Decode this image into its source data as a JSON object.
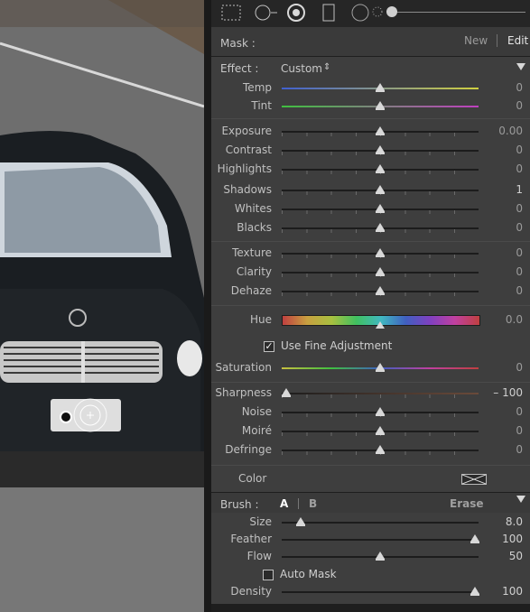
{
  "toolbar": {
    "tools": [
      "grid-select-icon",
      "radial-add-icon",
      "radial-filter-icon",
      "graduated-filter-icon",
      "circle-icon",
      "brightness-icon"
    ]
  },
  "mask": {
    "label": "Mask :",
    "new_label": "New",
    "edit_label": "Edit"
  },
  "effect": {
    "label": "Effect :",
    "preset": "Custom"
  },
  "sliders": {
    "temp": {
      "label": "Temp",
      "value": "0",
      "pos": 0.5
    },
    "tint": {
      "label": "Tint",
      "value": "0",
      "pos": 0.5
    },
    "exposure": {
      "label": "Exposure",
      "value": "0.00",
      "pos": 0.5
    },
    "contrast": {
      "label": "Contrast",
      "value": "0",
      "pos": 0.5
    },
    "highlights": {
      "label": "Highlights",
      "value": "0",
      "pos": 0.5
    },
    "shadows": {
      "label": "Shadows",
      "value": "1",
      "pos": 0.5
    },
    "whites": {
      "label": "Whites",
      "value": "0",
      "pos": 0.5
    },
    "blacks": {
      "label": "Blacks",
      "value": "0",
      "pos": 0.5
    },
    "texture": {
      "label": "Texture",
      "value": "0",
      "pos": 0.5
    },
    "clarity": {
      "label": "Clarity",
      "value": "0",
      "pos": 0.5
    },
    "dehaze": {
      "label": "Dehaze",
      "value": "0",
      "pos": 0.5
    },
    "hue": {
      "label": "Hue",
      "value": "0.0",
      "pos": 0.5
    },
    "saturation": {
      "label": "Saturation",
      "value": "0",
      "pos": 0.5
    },
    "sharpness": {
      "label": "Sharpness",
      "value": "– 100",
      "pos": 0.02
    },
    "noise": {
      "label": "Noise",
      "value": "0",
      "pos": 0.5
    },
    "moire": {
      "label": "Moiré",
      "value": "0",
      "pos": 0.5
    },
    "defringe": {
      "label": "Defringe",
      "value": "0",
      "pos": 0.5
    }
  },
  "fine_adjust": {
    "label": "Use Fine Adjustment",
    "checked": true
  },
  "color": {
    "label": "Color"
  },
  "brush": {
    "label": "Brush :",
    "a_label": "A",
    "b_label": "B",
    "erase_label": "Erase",
    "size": {
      "label": "Size",
      "value": "8.0",
      "pos": 0.1
    },
    "feather": {
      "label": "Feather",
      "value": "100",
      "pos": 1.0
    },
    "flow": {
      "label": "Flow",
      "value": "50",
      "pos": 0.5
    },
    "auto_mask": {
      "label": "Auto Mask",
      "checked": false
    },
    "density": {
      "label": "Density",
      "value": "100",
      "pos": 1.0
    }
  }
}
